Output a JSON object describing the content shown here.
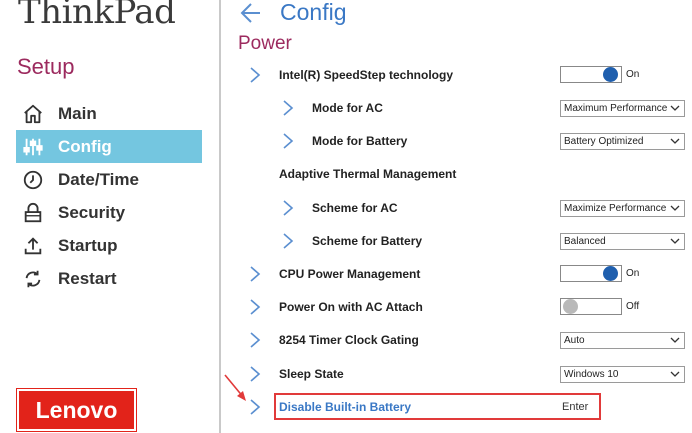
{
  "sidebar": {
    "brand": "ThinkPad",
    "title": "Setup",
    "items": [
      {
        "label": "Main",
        "icon": "home-icon"
      },
      {
        "label": "Config",
        "icon": "sliders-icon",
        "active": true
      },
      {
        "label": "Date/Time",
        "icon": "clock-icon"
      },
      {
        "label": "Security",
        "icon": "lock-icon"
      },
      {
        "label": "Startup",
        "icon": "upload-icon"
      },
      {
        "label": "Restart",
        "icon": "restart-icon"
      }
    ],
    "logo": "Lenovo"
  },
  "header": {
    "back_icon": "back-arrow-icon",
    "title": "Config",
    "section": "Power"
  },
  "settings": [
    {
      "label": "Intel(R) SpeedStep technology",
      "control": "toggle",
      "state": "On"
    },
    {
      "label": "Mode for AC",
      "control": "select",
      "value": "Maximum Performance"
    },
    {
      "label": "Mode for Battery",
      "control": "select",
      "value": "Battery Optimized"
    },
    {
      "label": "Adaptive Thermal Management",
      "control": "heading"
    },
    {
      "label": "Scheme for AC",
      "control": "select",
      "value": "Maximize Performance"
    },
    {
      "label": "Scheme for Battery",
      "control": "select",
      "value": "Balanced"
    },
    {
      "label": "CPU Power Management",
      "control": "toggle",
      "state": "On"
    },
    {
      "label": "Power On with AC Attach",
      "control": "toggle",
      "state": "Off"
    },
    {
      "label": "8254 Timer Clock Gating",
      "control": "select",
      "value": "Auto"
    },
    {
      "label": "Sleep State",
      "control": "select",
      "value": "Windows 10"
    },
    {
      "label": "Disable Built-in Battery",
      "control": "action",
      "value": "Enter"
    }
  ],
  "colors": {
    "accent_blue": "#3a78c5",
    "active_nav": "#74c6e0",
    "section_color": "#9c2a5e",
    "toggle_on": "#1f5fae",
    "highlight": "#e13a3a",
    "lenovo_red": "#e2231a"
  }
}
